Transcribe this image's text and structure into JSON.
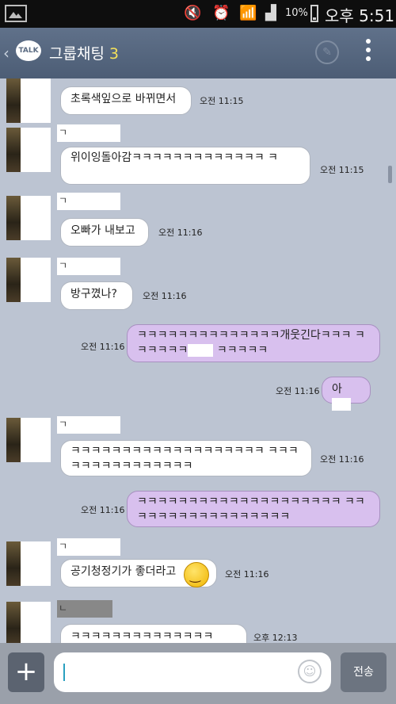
{
  "status_bar": {
    "battery": "10%",
    "time": "오후 5:51"
  },
  "header": {
    "back": "‹",
    "logo": "TALK",
    "title": "그룹채팅",
    "count": "3"
  },
  "messages": [
    {
      "text": "초록색잎으로 바뀌면서",
      "time": "오전 11:15"
    },
    {
      "text": "위이잉돌아감ㅋㅋㅋㅋㅋㅋㅋㅋㅋㅋㅋㅋㅋ ㅋ",
      "time": "오전 11:15"
    },
    {
      "text": "오빠가 내보고",
      "time": "오전 11:16"
    },
    {
      "text": "방구꼈나?",
      "time": "오전 11:16"
    },
    {
      "text_a": "ㅋㅋㅋㅋㅋㅋㅋㅋㅋㅋㅋㅋㅋㅋ개웃긴다ㅋㅋㅋ",
      "text_b": "ㅋㅋㅋㅋㅋㅋ",
      "text_c": "ㅋㅋㅋㅋㅋ",
      "time": "오전 11:16"
    },
    {
      "text": "아",
      "time": "오전 11:16"
    },
    {
      "text": "ㅋㅋㅋㅋㅋㅋㅋㅋㅋㅋㅋㅋㅋㅋㅋㅋㅋㅋㅋ ㅋㅋㅋㅋㅋㅋㅋㅋㅋㅋㅋㅋㅋㅋㅋ",
      "time": "오전 11:16"
    },
    {
      "text": "ㅋㅋㅋㅋㅋㅋㅋㅋㅋㅋㅋㅋㅋㅋㅋㅋㅋㅋㅋㅋ ㅋㅋㅋㅋㅋㅋㅋㅋㅋㅋㅋㅋㅋㅋㅋㅋㅋ",
      "time": "오전 11:16"
    },
    {
      "text": "공기청정기가 좋더라고",
      "time": "오전 11:16"
    },
    {
      "text": "ㅋㅋㅋㅋㅋㅋㅋㅋㅋㅋㅋㅋㅋㅋ",
      "time": "오후 12:13"
    }
  ],
  "names": {
    "a": "ㄱ",
    "b": "ㄱ",
    "c": "ㄱ",
    "d": "ㄱ",
    "e": "ㄱ",
    "f": "ㄴ"
  },
  "input": {
    "send": "전송"
  }
}
